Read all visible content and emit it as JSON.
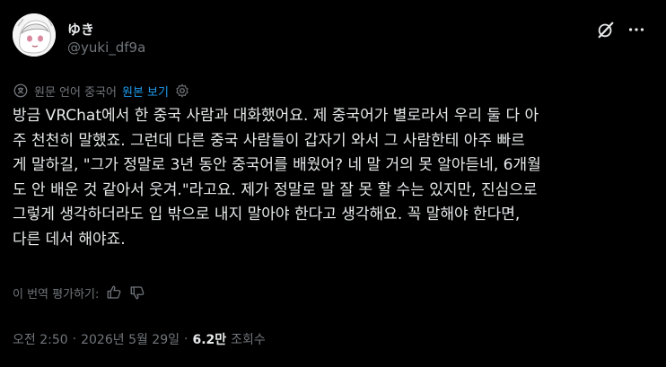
{
  "author": {
    "display_name": "ゆき",
    "handle": "@yuki_df9a"
  },
  "translation": {
    "label": "원문 언어 중국어",
    "view_original": "원본 보기"
  },
  "post": {
    "text": "방금 VRChat에서 한 중국 사람과 대화했어요. 제 중국어가 별로라서 우리 둘 다 아\n주 천천히 말했죠. 그런데 다른 중국 사람들이 갑자기 와서 그 사람한테 아주 빠르\n게 말하길, \"그가 정말로 3년 동안 중국어를 배웠어? 네 말 거의 못 알아듣네, 6개월\n도 안 배운 것 같아서 웃겨.\"라고요. 제가 정말로 말 잘 못 할 수는 있지만, 진심으로\n그렇게 생각하더라도 입 밖으로 내지 말아야 한다고 생각해요. 꼭 말해야 한다면,\n다른 데서 해야죠."
  },
  "rating": {
    "label": "이 번역 평가하기:"
  },
  "meta": {
    "time": "오전 2:50",
    "sep1": "·",
    "date": "2026년 5월 29일",
    "sep2": "·",
    "views": "6.2만",
    "views_label": "조회수"
  },
  "icons": {
    "grok": "grok-icon",
    "more": "more-icon",
    "translate": "translate-icon",
    "settings": "gear-icon",
    "thumbs_up": "thumbs-up-icon",
    "thumbs_down": "thumbs-down-icon"
  },
  "colors": {
    "background": "#000000",
    "text": "#e7e9ea",
    "secondary": "#71767b",
    "link": "#1d9bf0"
  }
}
